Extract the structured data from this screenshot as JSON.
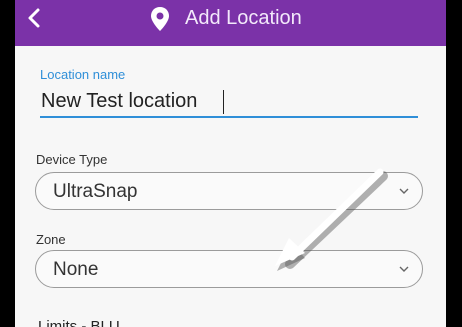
{
  "appbar": {
    "title": "Add Location",
    "color": "#7b32a8"
  },
  "form": {
    "location_name": {
      "label": "Location name",
      "value": "New Test location"
    },
    "device_type": {
      "label": "Device Type",
      "selected": "UltraSnap"
    },
    "zone": {
      "label": "Zone",
      "selected": "None"
    },
    "limits": {
      "label": "Limits - BLU"
    }
  },
  "icons": {
    "back": "chevron-left-icon",
    "location": "map-pin-icon",
    "dropdown": "chevron-down-icon",
    "annotation": "arrow-icon"
  },
  "colors": {
    "accent": "#2f8fd8",
    "appbar": "#7b32a8"
  }
}
